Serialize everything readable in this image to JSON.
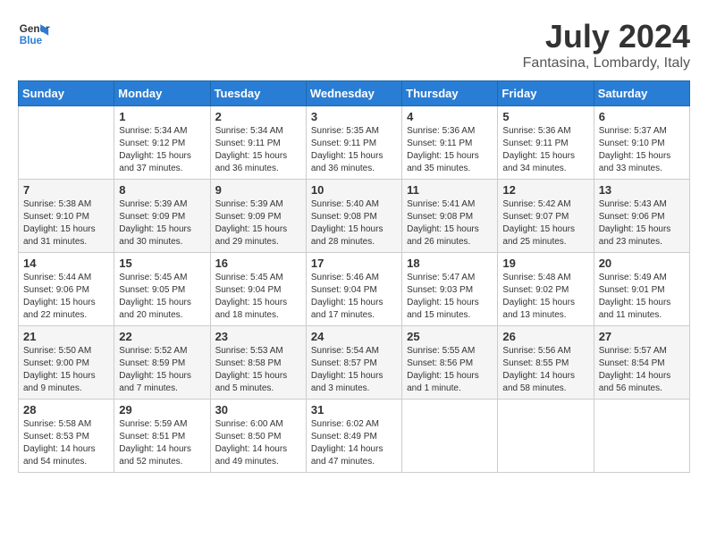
{
  "logo": {
    "line1": "General",
    "line2": "Blue"
  },
  "title": "July 2024",
  "location": "Fantasina, Lombardy, Italy",
  "days_header": [
    "Sunday",
    "Monday",
    "Tuesday",
    "Wednesday",
    "Thursday",
    "Friday",
    "Saturday"
  ],
  "weeks": [
    [
      {
        "num": "",
        "info": ""
      },
      {
        "num": "1",
        "info": "Sunrise: 5:34 AM\nSunset: 9:12 PM\nDaylight: 15 hours\nand 37 minutes."
      },
      {
        "num": "2",
        "info": "Sunrise: 5:34 AM\nSunset: 9:11 PM\nDaylight: 15 hours\nand 36 minutes."
      },
      {
        "num": "3",
        "info": "Sunrise: 5:35 AM\nSunset: 9:11 PM\nDaylight: 15 hours\nand 36 minutes."
      },
      {
        "num": "4",
        "info": "Sunrise: 5:36 AM\nSunset: 9:11 PM\nDaylight: 15 hours\nand 35 minutes."
      },
      {
        "num": "5",
        "info": "Sunrise: 5:36 AM\nSunset: 9:11 PM\nDaylight: 15 hours\nand 34 minutes."
      },
      {
        "num": "6",
        "info": "Sunrise: 5:37 AM\nSunset: 9:10 PM\nDaylight: 15 hours\nand 33 minutes."
      }
    ],
    [
      {
        "num": "7",
        "info": "Sunrise: 5:38 AM\nSunset: 9:10 PM\nDaylight: 15 hours\nand 31 minutes."
      },
      {
        "num": "8",
        "info": "Sunrise: 5:39 AM\nSunset: 9:09 PM\nDaylight: 15 hours\nand 30 minutes."
      },
      {
        "num": "9",
        "info": "Sunrise: 5:39 AM\nSunset: 9:09 PM\nDaylight: 15 hours\nand 29 minutes."
      },
      {
        "num": "10",
        "info": "Sunrise: 5:40 AM\nSunset: 9:08 PM\nDaylight: 15 hours\nand 28 minutes."
      },
      {
        "num": "11",
        "info": "Sunrise: 5:41 AM\nSunset: 9:08 PM\nDaylight: 15 hours\nand 26 minutes."
      },
      {
        "num": "12",
        "info": "Sunrise: 5:42 AM\nSunset: 9:07 PM\nDaylight: 15 hours\nand 25 minutes."
      },
      {
        "num": "13",
        "info": "Sunrise: 5:43 AM\nSunset: 9:06 PM\nDaylight: 15 hours\nand 23 minutes."
      }
    ],
    [
      {
        "num": "14",
        "info": "Sunrise: 5:44 AM\nSunset: 9:06 PM\nDaylight: 15 hours\nand 22 minutes."
      },
      {
        "num": "15",
        "info": "Sunrise: 5:45 AM\nSunset: 9:05 PM\nDaylight: 15 hours\nand 20 minutes."
      },
      {
        "num": "16",
        "info": "Sunrise: 5:45 AM\nSunset: 9:04 PM\nDaylight: 15 hours\nand 18 minutes."
      },
      {
        "num": "17",
        "info": "Sunrise: 5:46 AM\nSunset: 9:04 PM\nDaylight: 15 hours\nand 17 minutes."
      },
      {
        "num": "18",
        "info": "Sunrise: 5:47 AM\nSunset: 9:03 PM\nDaylight: 15 hours\nand 15 minutes."
      },
      {
        "num": "19",
        "info": "Sunrise: 5:48 AM\nSunset: 9:02 PM\nDaylight: 15 hours\nand 13 minutes."
      },
      {
        "num": "20",
        "info": "Sunrise: 5:49 AM\nSunset: 9:01 PM\nDaylight: 15 hours\nand 11 minutes."
      }
    ],
    [
      {
        "num": "21",
        "info": "Sunrise: 5:50 AM\nSunset: 9:00 PM\nDaylight: 15 hours\nand 9 minutes."
      },
      {
        "num": "22",
        "info": "Sunrise: 5:52 AM\nSunset: 8:59 PM\nDaylight: 15 hours\nand 7 minutes."
      },
      {
        "num": "23",
        "info": "Sunrise: 5:53 AM\nSunset: 8:58 PM\nDaylight: 15 hours\nand 5 minutes."
      },
      {
        "num": "24",
        "info": "Sunrise: 5:54 AM\nSunset: 8:57 PM\nDaylight: 15 hours\nand 3 minutes."
      },
      {
        "num": "25",
        "info": "Sunrise: 5:55 AM\nSunset: 8:56 PM\nDaylight: 15 hours\nand 1 minute."
      },
      {
        "num": "26",
        "info": "Sunrise: 5:56 AM\nSunset: 8:55 PM\nDaylight: 14 hours\nand 58 minutes."
      },
      {
        "num": "27",
        "info": "Sunrise: 5:57 AM\nSunset: 8:54 PM\nDaylight: 14 hours\nand 56 minutes."
      }
    ],
    [
      {
        "num": "28",
        "info": "Sunrise: 5:58 AM\nSunset: 8:53 PM\nDaylight: 14 hours\nand 54 minutes."
      },
      {
        "num": "29",
        "info": "Sunrise: 5:59 AM\nSunset: 8:51 PM\nDaylight: 14 hours\nand 52 minutes."
      },
      {
        "num": "30",
        "info": "Sunrise: 6:00 AM\nSunset: 8:50 PM\nDaylight: 14 hours\nand 49 minutes."
      },
      {
        "num": "31",
        "info": "Sunrise: 6:02 AM\nSunset: 8:49 PM\nDaylight: 14 hours\nand 47 minutes."
      },
      {
        "num": "",
        "info": ""
      },
      {
        "num": "",
        "info": ""
      },
      {
        "num": "",
        "info": ""
      }
    ]
  ]
}
